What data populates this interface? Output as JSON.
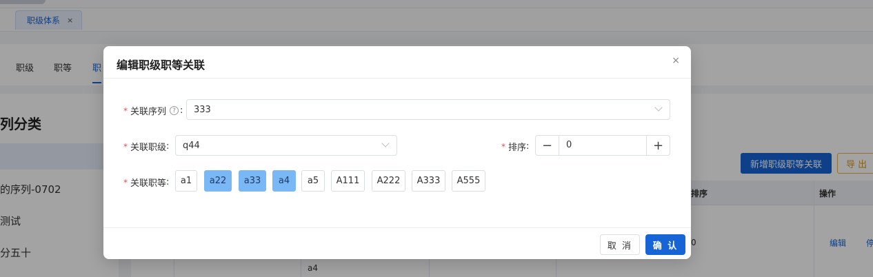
{
  "tabs": {
    "open_tab": "职级体系",
    "close_glyph": "×"
  },
  "subnav": {
    "items": [
      "职级",
      "职等",
      "职"
    ]
  },
  "left_panel": {
    "title": "列分类",
    "items": [
      "的序列-0702",
      "测试",
      "分五十"
    ]
  },
  "toolbar": {
    "add_label": "新增职级职等关联",
    "export_label": "导 出"
  },
  "table": {
    "headers": {
      "sort": "排序",
      "actions": "操作"
    },
    "row": {
      "sort_value": "0",
      "edit_link": "编辑",
      "next_link": "停",
      "grade_tail": "a4"
    }
  },
  "modal": {
    "title": "编辑职级职等关联",
    "close_glyph": "×",
    "fields": {
      "sequence": {
        "label": "关联序列",
        "help": "?",
        "colon": ":",
        "value": "333"
      },
      "rank": {
        "label": "关联职级",
        "colon": ":",
        "value": "q44"
      },
      "order": {
        "label": "排序",
        "colon": ":",
        "value": "0",
        "minus": "−",
        "plus": "+"
      },
      "grades": {
        "label": "关联职等",
        "colon": ":",
        "options": [
          {
            "label": "a1",
            "selected": false
          },
          {
            "label": "a22",
            "selected": true
          },
          {
            "label": "a33",
            "selected": true
          },
          {
            "label": "a4",
            "selected": true
          },
          {
            "label": "a5",
            "selected": false
          },
          {
            "label": "A111",
            "selected": false
          },
          {
            "label": "A222",
            "selected": false
          },
          {
            "label": "A333",
            "selected": false
          },
          {
            "label": "A555",
            "selected": false
          }
        ]
      }
    },
    "required_mark": "*",
    "cancel_label": "取 消",
    "confirm_label": "确 认"
  },
  "colors": {
    "primary": "#1764d6",
    "chip_selected": "#7ab7f5",
    "required": "#e34d59"
  }
}
